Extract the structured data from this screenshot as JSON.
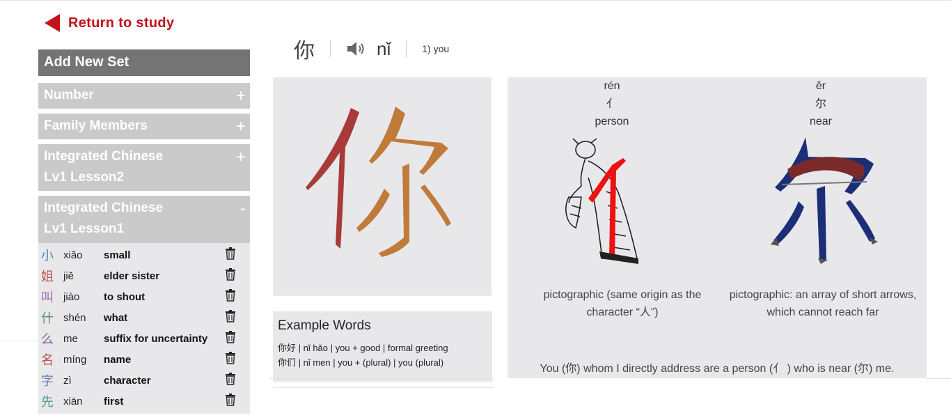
{
  "nav": {
    "return_label": "Return to study"
  },
  "sidebar": {
    "add_set_label": "Add New Set",
    "sets": [
      {
        "title": "Number",
        "toggle": "+"
      },
      {
        "title": "Family Members",
        "toggle": "+"
      },
      {
        "title_line1": "Integrated Chinese",
        "title_line2": "Lv1 Lesson2",
        "toggle": "+"
      },
      {
        "title_line1": "Integrated Chinese",
        "title_line2": "Lv1 Lesson1",
        "toggle": "-"
      }
    ],
    "words": [
      {
        "char": "小",
        "pinyin": "xiǎo",
        "meaning": "small",
        "color": "#4a86a8"
      },
      {
        "char": "姐",
        "pinyin": "jiě",
        "meaning": "elder sister",
        "color": "#b5544d"
      },
      {
        "char": "叫",
        "pinyin": "jiào",
        "meaning": "to shout",
        "color": "#9b6fb0"
      },
      {
        "char": "什",
        "pinyin": "shén",
        "meaning": "what",
        "color": "#5d8a5b"
      },
      {
        "char": "么",
        "pinyin": "me",
        "meaning": "suffix for uncertainty",
        "color": "#8a5d9c"
      },
      {
        "char": "名",
        "pinyin": "míng",
        "meaning": "name",
        "color": "#b5544d"
      },
      {
        "char": "字",
        "pinyin": "zì",
        "meaning": "character",
        "color": "#6a7fb0"
      },
      {
        "char": "先",
        "pinyin": "xiān",
        "meaning": "first",
        "color": "#4d9a8a"
      }
    ]
  },
  "header": {
    "hanzi": "你",
    "pinyin": "nǐ",
    "definition": "1) you"
  },
  "character": {
    "hanzi": "你"
  },
  "examples": {
    "title": "Example Words",
    "rows": [
      "你好 | nǐ hǎo  | you + good    | formal greeting",
      "你们 | nǐ men | you + (plural) | you (plural)"
    ]
  },
  "etymology": {
    "components": [
      {
        "pinyin": "rén",
        "char": "亻",
        "meaning": "person"
      },
      {
        "pinyin": "ěr",
        "char": "尔",
        "meaning": "near"
      }
    ],
    "notes": [
      {
        "line1": "pictographic (same origin as the",
        "line2": "character “人”)"
      },
      {
        "line1": "pictographic: an array of short arrows,",
        "line2": "which cannot reach far"
      }
    ],
    "summary": "You (你) whom I directly address are a person (亻 ) who is near (尔) me."
  },
  "colors": {
    "accent_red": "#c4121a",
    "header_gray": "#757373",
    "set_gray": "#cacaca",
    "panel_bg": "#e8e8ea",
    "stroke_left": "#a83a3a",
    "stroke_right": "#c07a3a",
    "radical_red": "#ee1111",
    "arrow_navy": "#1c2e78"
  }
}
